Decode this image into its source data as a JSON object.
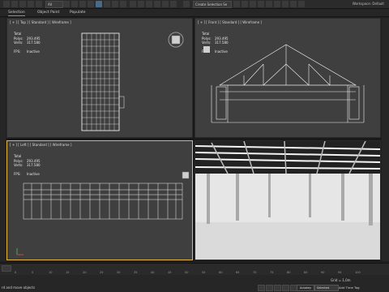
{
  "toolbar": {
    "dropdown_all": "All",
    "create_selection_set": "Create Selection Se",
    "workspace": "Workspace: Default"
  },
  "menu": {
    "tabs": [
      {
        "label": "Selection"
      },
      {
        "label": "Object Paint"
      },
      {
        "label": "Populate"
      }
    ]
  },
  "viewports": {
    "top": {
      "label": "[ + ] [ Top ] [ Standard ] [ Wireframe ]",
      "stats": {
        "total": "Total",
        "polys_label": "Polys:",
        "polys": "293.495",
        "verts_label": "Verts:",
        "verts": "317.580",
        "fps_label": "FPS:",
        "fps": "Inactive"
      }
    },
    "front": {
      "label": "[ + ] [ Front ] [ Standard ] [ Wireframe ]",
      "stats": {
        "total": "Total",
        "polys_label": "Polys:",
        "polys": "293.495",
        "verts_label": "Verts:",
        "verts": "317.580",
        "fps_label": "FPS:",
        "fps": "Inactive"
      }
    },
    "left": {
      "label": "[ + ] [ Left ] [ Standard ] [ Wireframe ]",
      "stats": {
        "total": "Total",
        "polys_label": "Polys:",
        "polys": "293.495",
        "verts_label": "Verts:",
        "verts": "317.580",
        "fps_label": "FPS:",
        "fps": "Inactive"
      }
    }
  },
  "timeline": {
    "ticks": [
      "0",
      "5",
      "10",
      "15",
      "20",
      "25",
      "30",
      "35",
      "40",
      "45",
      "50",
      "55",
      "60",
      "65",
      "70",
      "75",
      "80",
      "85",
      "90",
      "95",
      "100"
    ]
  },
  "status": {
    "message": "rd and move objects",
    "grid": "Grid = 1,0m",
    "autokey": "Autokey",
    "selected": "Selected",
    "add_time_tag": "Add Time Tag"
  }
}
